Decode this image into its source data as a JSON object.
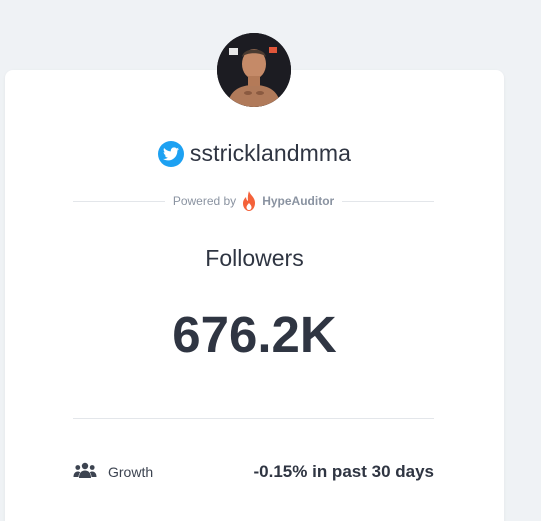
{
  "profile": {
    "avatar_icon": "profile-photo",
    "platform_icon": "twitter-icon",
    "handle": "sstricklandmma"
  },
  "powered_by": {
    "prefix": "Powered by",
    "brand": "HypeAuditor",
    "brand_icon": "flame-icon",
    "brand_color": "#f4623a"
  },
  "followers": {
    "label": "Followers",
    "value": "676.2K"
  },
  "growth": {
    "icon": "users-icon",
    "label": "Growth",
    "value": "-0.15% in past 30 days"
  },
  "colors": {
    "background": "#eff2f5",
    "card": "#ffffff",
    "text": "#2f3542",
    "twitter": "#1da1f2"
  }
}
